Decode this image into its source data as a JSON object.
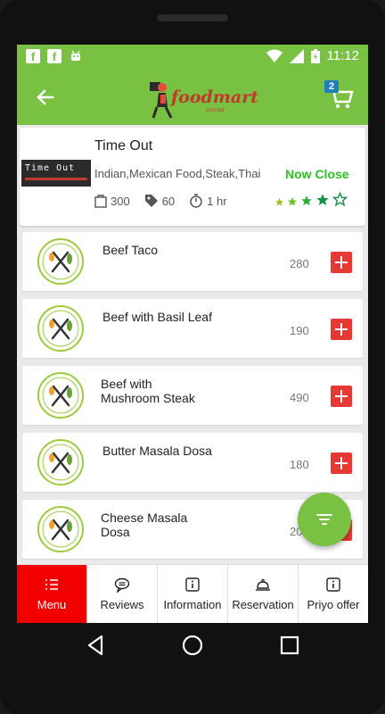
{
  "status_bar": {
    "notifications": [
      "facebook-icon",
      "facebook-icon",
      "android-icon"
    ],
    "time": "11:12"
  },
  "app_bar": {
    "logo_text": "foodmart",
    "logo_sub": ".com.bd",
    "cart_count": "2"
  },
  "restaurant": {
    "name": "Time Out",
    "logo_text": "Time Out",
    "cuisine": "Indian,Mexican Food,Steak,Thai",
    "status": "Now Close",
    "min_order": "300",
    "delivery_fee": "60",
    "delivery_time": "1 hr",
    "rating": 4,
    "rating_max": 5
  },
  "menu_items": [
    {
      "name": "Beef Taco",
      "price": "280"
    },
    {
      "name": "Beef with Basil Leaf",
      "price": "190"
    },
    {
      "name": "Beef with\nMushroom Steak",
      "price": "490"
    },
    {
      "name": "Butter Masala Dosa",
      "price": "180"
    },
    {
      "name": "Cheese Masala\nDosa",
      "price": "20"
    }
  ],
  "tabs": [
    {
      "label": "Menu",
      "icon": "list-icon",
      "active": true
    },
    {
      "label": "Reviews",
      "icon": "chat-icon",
      "active": false
    },
    {
      "label": "Information",
      "icon": "info-icon",
      "active": false
    },
    {
      "label": "Reservation",
      "icon": "cloche-icon",
      "active": false
    },
    {
      "label": "Priyo offer",
      "icon": "info-icon",
      "active": false
    }
  ],
  "colors": {
    "brand_green": "#79c142",
    "status_green": "#2ec21f",
    "add_red": "#e53935",
    "tab_active_red": "#f20000",
    "badge_blue": "#1e7fbf"
  }
}
